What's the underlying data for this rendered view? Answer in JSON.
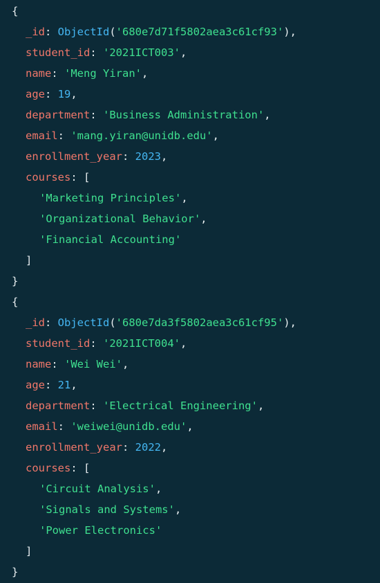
{
  "documents": [
    {
      "open_brace": "{",
      "close_brace": "}",
      "id_key": "_id",
      "id_fn": "ObjectId",
      "id_value": "'680e7d71f5802aea3c61cf93'",
      "student_id_key": "student_id",
      "student_id": "'2021ICT003'",
      "name_key": "name",
      "name": "'Meng Yiran'",
      "age_key": "age",
      "age": "19",
      "department_key": "department",
      "department": "'Business Administration'",
      "email_key": "email",
      "email": "'mang.yiran@unidb.edu'",
      "enrollment_year_key": "enrollment_year",
      "enrollment_year": "2023",
      "courses_key": "courses",
      "courses_open": "[",
      "courses_close": "]",
      "courses": [
        "'Marketing Principles'",
        "'Organizational Behavior'",
        "'Financial Accounting'"
      ]
    },
    {
      "open_brace": "{",
      "close_brace": "}",
      "id_key": "_id",
      "id_fn": "ObjectId",
      "id_value": "'680e7da3f5802aea3c61cf95'",
      "student_id_key": "student_id",
      "student_id": "'2021ICT004'",
      "name_key": "name",
      "name": "'Wei Wei'",
      "age_key": "age",
      "age": "21",
      "department_key": "department",
      "department": "'Electrical Engineering'",
      "email_key": "email",
      "email": "'weiwei@unidb.edu'",
      "enrollment_year_key": "enrollment_year",
      "enrollment_year": "2022",
      "courses_key": "courses",
      "courses_open": "[",
      "courses_close": "]",
      "courses": [
        "'Circuit Analysis'",
        "'Signals and Systems'",
        "'Power Electronics'"
      ]
    }
  ],
  "colors": {
    "background": "#0c2a37",
    "key": "#f0776a",
    "string": "#3fe08f",
    "number": "#45b6f2",
    "punctuation": "#e8eef0"
  }
}
